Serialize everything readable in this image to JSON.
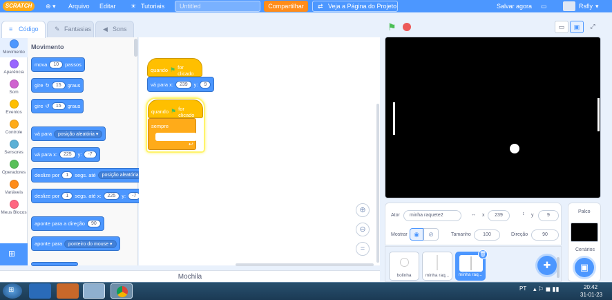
{
  "menubar": {
    "logo": "SCRATCH",
    "file": "Arquivo",
    "edit": "Editar",
    "tutorials": "Tutoriais",
    "project_title": "Untitled",
    "share": "Compartilhar",
    "see_project": "Veja a Página do Projeto",
    "save_now": "Salvar agora",
    "username": "Rsfly"
  },
  "tabs": {
    "code": "Código",
    "costumes": "Fantasias",
    "sounds": "Sons"
  },
  "categories": [
    {
      "label": "Movimento",
      "color": "#4c97ff"
    },
    {
      "label": "Aparência",
      "color": "#9966ff"
    },
    {
      "label": "Som",
      "color": "#cf63cf"
    },
    {
      "label": "Eventos",
      "color": "#ffbf00"
    },
    {
      "label": "Controle",
      "color": "#ffab19"
    },
    {
      "label": "Sensores",
      "color": "#5cb1d6"
    },
    {
      "label": "Operadores",
      "color": "#59c059"
    },
    {
      "label": "Variáveis",
      "color": "#ff8c1a"
    },
    {
      "label": "Meus Blocos",
      "color": "#ff6680"
    }
  ],
  "palette": {
    "section_title": "Movimento",
    "move": {
      "a": "mova",
      "steps": "10",
      "b": "passos"
    },
    "turn_right": {
      "a": "gire",
      "deg": "15",
      "b": "graus"
    },
    "turn_left": {
      "a": "gire",
      "deg": "15",
      "b": "graus"
    },
    "goto": {
      "a": "vá para",
      "target": "posição aleatória ▾"
    },
    "goto_xy": {
      "a": "vá para x:",
      "x": "225",
      "b": "y:",
      "y": "-7"
    },
    "glide": {
      "a": "deslize por",
      "secs": "1",
      "b": "segs. até",
      "target": "posição aleatória"
    },
    "glide_xy": {
      "a": "deslize por",
      "secs": "1",
      "b": "segs. até x:",
      "x": "225",
      "c": "y:",
      "y": "-7"
    },
    "point_dir": {
      "a": "aponte para a direção",
      "dir": "90"
    },
    "point_to": {
      "a": "aponte para",
      "target": "ponteiro do mouse ▾"
    }
  },
  "script": {
    "hat1": {
      "a": "quando",
      "b": "for clicado"
    },
    "goto1": {
      "a": "vá para x:",
      "x": "239",
      "b": "y:",
      "y": "9"
    },
    "hat2": {
      "a": "quando",
      "b": "for clicado"
    },
    "forever": "sempre"
  },
  "backpack": "Mochila",
  "sprite_info": {
    "sprite_label": "Ator",
    "sprite_name": "minha raquete2",
    "x_label": "x",
    "x": "239",
    "y_label": "y",
    "y": "9",
    "show_label": "Mostrar",
    "size_label": "Tamanho",
    "size": "100",
    "direction_label": "Direção",
    "direction": "90"
  },
  "sprites": [
    {
      "name": "bolinha"
    },
    {
      "name": "minha raq..."
    },
    {
      "name": "minha raq..."
    }
  ],
  "stage_panel": {
    "label": "Palco",
    "backdrops": "Cenários"
  },
  "taskbar": {
    "lang": "PT",
    "time": "20:42",
    "date": "31-01-23"
  }
}
